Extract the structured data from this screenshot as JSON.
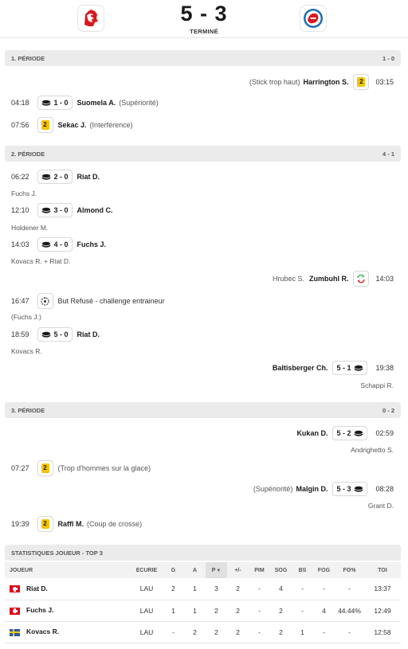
{
  "match": {
    "score": "5 - 3",
    "status": "TERMINÉ",
    "home_logo": "lausanne-lion-logo-icon",
    "away_logo": "zsc-lions-logo-icon"
  },
  "periods": [
    {
      "title": "1. PÉRIODE",
      "score": "1 - 0",
      "events": [
        {
          "time": "03:15",
          "type": "penalty",
          "minutes": "2",
          "player": "Harrington S.",
          "note": "(Stick trop haut)"
        },
        {
          "time": "04:18",
          "type": "goal",
          "score": "1 - 0",
          "player": "Suomela A.",
          "note": "(Supériorité)"
        },
        {
          "time": "07:56",
          "type": "penalty",
          "minutes": "2",
          "player": "Sekac J.",
          "note": "(Interférence)"
        }
      ]
    },
    {
      "title": "2. PÉRIODE",
      "score": "4 - 1",
      "events": [
        {
          "time": "06:22",
          "type": "goal",
          "score": "2 - 0",
          "player": "Riat D.",
          "assists": "Fuchs J."
        },
        {
          "time": "12:10",
          "type": "goal",
          "score": "3 - 0",
          "player": "Almond C.",
          "assists": "Holdener M."
        },
        {
          "time": "14:03",
          "type": "goal",
          "score": "4 - 0",
          "player": "Fuchs J.",
          "assists": "Kovacs R. + Riat D."
        },
        {
          "time": "14:03",
          "type": "goalie-change",
          "player": "Zumbuhl R.",
          "note": "Hrubec S."
        },
        {
          "time": "16:47",
          "type": "challenge",
          "text": "But Refusé - challenge entraineur",
          "note": "(Fuchs J.)"
        },
        {
          "time": "18:59",
          "type": "goal",
          "score": "5 - 0",
          "player": "Riat D.",
          "assists": "Kovacs R."
        },
        {
          "time": "19:38",
          "type": "goal",
          "score": "5 - 1",
          "player": "Baltisberger Ch.",
          "assists": "Schappi R."
        }
      ]
    },
    {
      "title": "3. PÉRIODE",
      "score": "0 - 2",
      "events": [
        {
          "time": "02:59",
          "type": "goal",
          "score": "5 - 2",
          "player": "Kukan D.",
          "assists": "Andrighetto S."
        },
        {
          "time": "07:27",
          "type": "penalty",
          "minutes": "2",
          "note": "(Trop d'hommes sur la glace)"
        },
        {
          "time": "08:28",
          "type": "goal",
          "score": "5 - 3",
          "player": "Malgin D.",
          "note": "(Supériorité)",
          "assists": "Grant D."
        },
        {
          "time": "19:39",
          "type": "penalty",
          "minutes": "2",
          "player": "Raffl M.",
          "note": "(Coup de crosse)"
        }
      ]
    }
  ],
  "stats": {
    "title": "STATISTIQUES JOUEUR - TOP 3",
    "columns": [
      "JOUEUR",
      "ECURIE",
      "G",
      "A",
      "P",
      "+/-",
      "PIM",
      "SOG",
      "BS",
      "FOG",
      "FO%",
      "TOI"
    ],
    "sorted_indicator": "▼",
    "rows": [
      {
        "flag": "switzerland-flag-icon",
        "player": "Riat D.",
        "team": "LAU",
        "g": "2",
        "a": "1",
        "p": "3",
        "pm": "2",
        "pim": "-",
        "sog": "4",
        "bs": "-",
        "fog": "-",
        "fo": "-",
        "toi": "13:37"
      },
      {
        "flag": "switzerland-flag-icon",
        "player": "Fuchs J.",
        "team": "LAU",
        "g": "1",
        "a": "1",
        "p": "2",
        "pm": "2",
        "pim": "-",
        "sog": "2",
        "bs": "-",
        "fog": "4",
        "fo": "44.44%",
        "toi": "12:49"
      },
      {
        "flag": "sweden-flag-icon",
        "player": "Kovacs R.",
        "team": "LAU",
        "g": "-",
        "a": "2",
        "p": "2",
        "pm": "2",
        "pim": "-",
        "sog": "2",
        "bs": "1",
        "fog": "-",
        "fo": "-",
        "toi": "12:58"
      }
    ]
  },
  "colors": {
    "penalty": "#f5c400",
    "bar": "#ebebeb",
    "home_red": "#d7191f",
    "away_blue": "#1c6fb6"
  }
}
